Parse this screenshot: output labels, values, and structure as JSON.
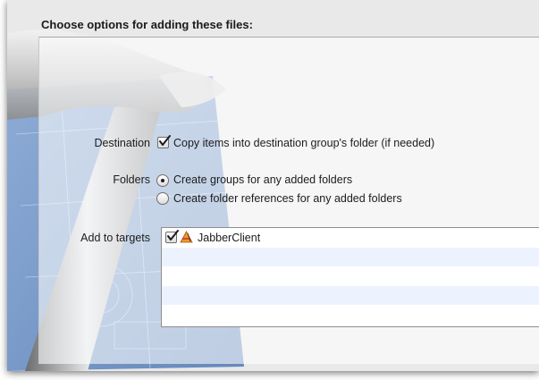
{
  "title": "Choose options for adding these files:",
  "destination": {
    "label": "Destination",
    "checkbox_label": "Copy items into destination group's folder (if needed)",
    "checked": true
  },
  "folders": {
    "label": "Folders",
    "options": [
      {
        "label": "Create groups for any added folders",
        "selected": true
      },
      {
        "label": "Create folder references for any added folders",
        "selected": false
      }
    ]
  },
  "targets": {
    "label": "Add to targets",
    "items": [
      {
        "name": "JabberClient",
        "checked": true,
        "icon": "application-target-icon"
      }
    ]
  },
  "colors": {
    "row_alt": "#edf3fe",
    "blueprint": "#5f87bf"
  }
}
